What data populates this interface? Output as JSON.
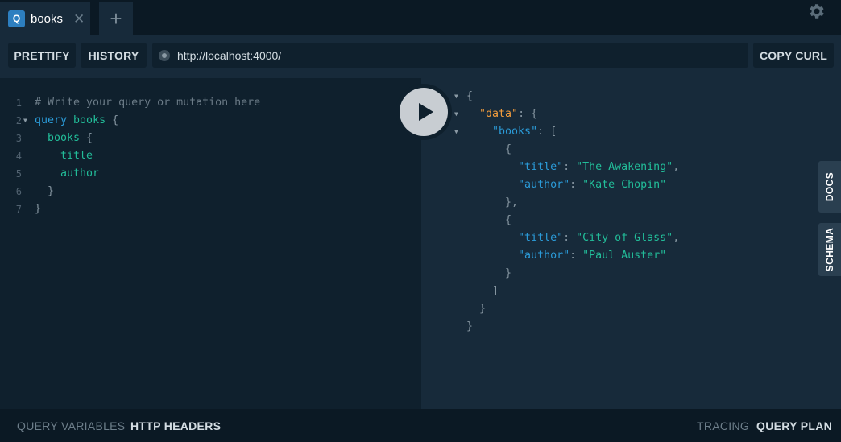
{
  "tabs": [
    {
      "badge": "Q",
      "title": "books",
      "close": "✕"
    }
  ],
  "add_tab": "+",
  "icons": {
    "settings": "gear-icon",
    "close": "close-icon",
    "add": "plus-icon",
    "run": "play-icon",
    "url_status": "status-dot-icon"
  },
  "toolbar": {
    "prettify": "PRETTIFY",
    "history": "HISTORY",
    "url": "http://localhost:4000/",
    "copy_curl": "COPY CURL"
  },
  "editor": {
    "lines": [
      {
        "n": "1",
        "parts": [
          {
            "t": "# Write your query or mutation here",
            "c": "comment"
          }
        ]
      },
      {
        "n": "2",
        "fold": true,
        "parts": [
          {
            "t": "query",
            "c": "kw"
          },
          {
            "t": " ",
            "c": "punc"
          },
          {
            "t": "books",
            "c": "name"
          },
          {
            "t": " {",
            "c": "punc"
          }
        ]
      },
      {
        "n": "3",
        "parts": [
          {
            "t": "  books",
            "c": "field"
          },
          {
            "t": " {",
            "c": "punc"
          }
        ]
      },
      {
        "n": "4",
        "parts": [
          {
            "t": "    title",
            "c": "field"
          }
        ]
      },
      {
        "n": "5",
        "parts": [
          {
            "t": "    author",
            "c": "field"
          }
        ]
      },
      {
        "n": "6",
        "parts": [
          {
            "t": "  }",
            "c": "punc"
          }
        ]
      },
      {
        "n": "7",
        "parts": [
          {
            "t": "}",
            "c": "punc"
          }
        ]
      }
    ]
  },
  "result": {
    "lines": [
      {
        "fold": true,
        "parts": [
          {
            "t": "{",
            "c": "punc"
          }
        ]
      },
      {
        "fold": true,
        "parts": [
          {
            "t": "  ",
            "c": "punc"
          },
          {
            "t": "\"data\"",
            "c": "keydata"
          },
          {
            "t": ": {",
            "c": "punc"
          }
        ]
      },
      {
        "fold": true,
        "parts": [
          {
            "t": "    ",
            "c": "punc"
          },
          {
            "t": "\"books\"",
            "c": "key"
          },
          {
            "t": ": [",
            "c": "punc"
          }
        ]
      },
      {
        "parts": [
          {
            "t": "      {",
            "c": "punc"
          }
        ]
      },
      {
        "parts": [
          {
            "t": "        ",
            "c": "punc"
          },
          {
            "t": "\"title\"",
            "c": "key"
          },
          {
            "t": ": ",
            "c": "punc"
          },
          {
            "t": "\"The Awakening\"",
            "c": "str"
          },
          {
            "t": ",",
            "c": "punc"
          }
        ]
      },
      {
        "parts": [
          {
            "t": "        ",
            "c": "punc"
          },
          {
            "t": "\"author\"",
            "c": "key"
          },
          {
            "t": ": ",
            "c": "punc"
          },
          {
            "t": "\"Kate Chopin\"",
            "c": "str"
          }
        ]
      },
      {
        "parts": [
          {
            "t": "      },",
            "c": "punc"
          }
        ]
      },
      {
        "parts": [
          {
            "t": "      {",
            "c": "punc"
          }
        ]
      },
      {
        "parts": [
          {
            "t": "        ",
            "c": "punc"
          },
          {
            "t": "\"title\"",
            "c": "key"
          },
          {
            "t": ": ",
            "c": "punc"
          },
          {
            "t": "\"City of Glass\"",
            "c": "str"
          },
          {
            "t": ",",
            "c": "punc"
          }
        ]
      },
      {
        "parts": [
          {
            "t": "        ",
            "c": "punc"
          },
          {
            "t": "\"author\"",
            "c": "key"
          },
          {
            "t": ": ",
            "c": "punc"
          },
          {
            "t": "\"Paul Auster\"",
            "c": "str"
          }
        ]
      },
      {
        "parts": [
          {
            "t": "      }",
            "c": "punc"
          }
        ]
      },
      {
        "parts": [
          {
            "t": "    ]",
            "c": "punc"
          }
        ]
      },
      {
        "parts": [
          {
            "t": "  }",
            "c": "punc"
          }
        ]
      },
      {
        "parts": [
          {
            "t": "}",
            "c": "punc"
          }
        ]
      }
    ]
  },
  "side_tabs": {
    "docs": "DOCS",
    "schema": "SCHEMA"
  },
  "footer": {
    "query_variables": "QUERY VARIABLES",
    "http_headers": "HTTP HEADERS",
    "tracing": "TRACING",
    "query_plan": "QUERY PLAN"
  },
  "colors": {
    "editor_bg": "#0f202d",
    "result_bg": "#172a3a",
    "keyword": "#2b9bd8",
    "field": "#22bd99",
    "data_key": "#f39c3c",
    "badge": "#2d7fc0"
  }
}
